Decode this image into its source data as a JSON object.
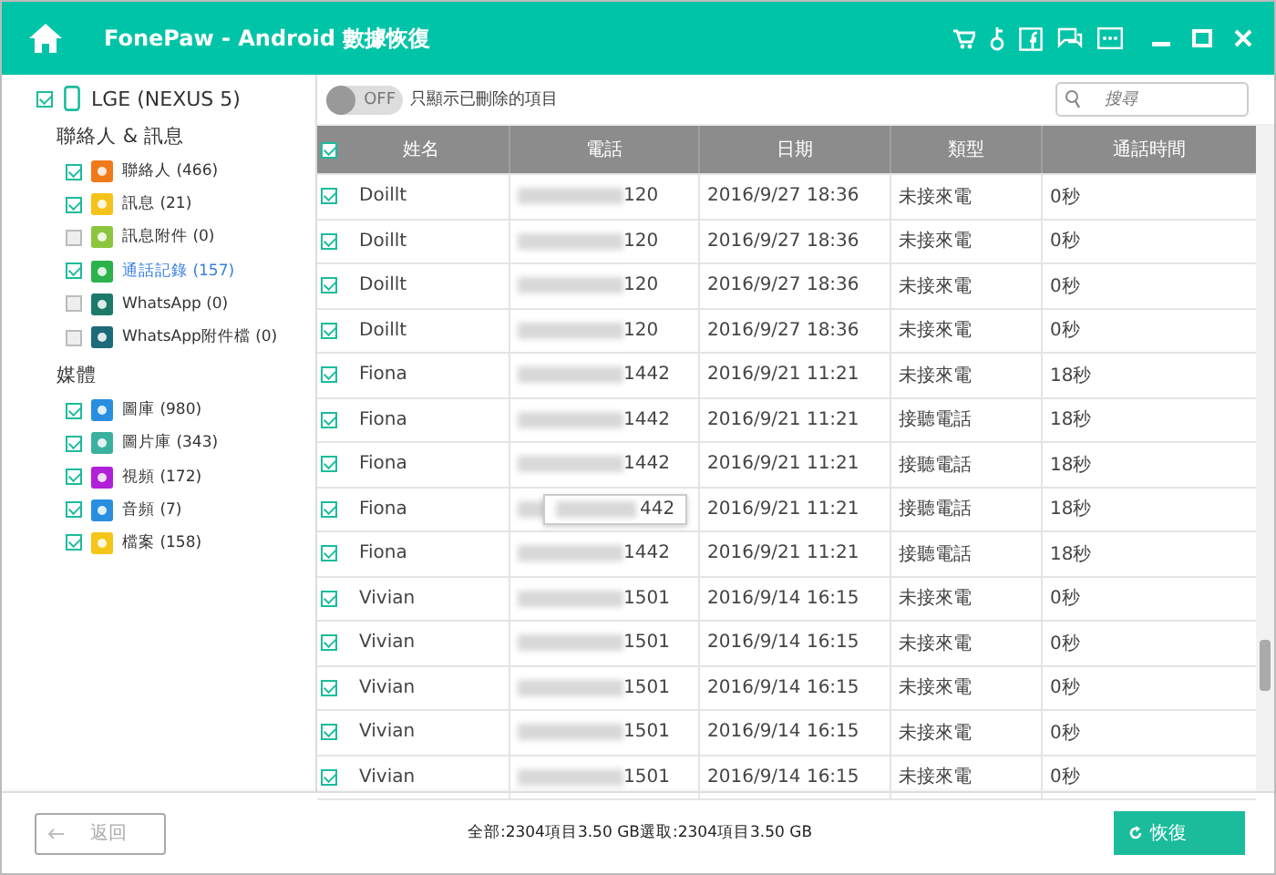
{
  "window": {
    "title": "FonePaw - Android 數據恢復"
  },
  "device": {
    "name": "LGE (NEXUS 5)",
    "checked": true
  },
  "groups": [
    {
      "title": "聯絡人 & 訊息",
      "items": [
        {
          "kind": "contacts",
          "label": "聯絡人 (466)",
          "checked": true,
          "selected": false
        },
        {
          "kind": "messages",
          "label": "訊息 (21)",
          "checked": true,
          "selected": false
        },
        {
          "kind": "attachments",
          "label": "訊息附件 (0)",
          "checked": false,
          "selected": false
        },
        {
          "kind": "calls",
          "label": "通話記錄 (157)",
          "checked": true,
          "selected": true
        },
        {
          "kind": "whatsapp",
          "label": "WhatsApp (0)",
          "checked": false,
          "selected": false
        },
        {
          "kind": "whatsapp-attachments",
          "label": "WhatsApp附件檔 (0)",
          "checked": false,
          "selected": false
        }
      ]
    },
    {
      "title": "媒體",
      "items": [
        {
          "kind": "gallery",
          "label": "圖庫 (980)",
          "checked": true,
          "selected": false
        },
        {
          "kind": "pictures",
          "label": "圖片庫 (343)",
          "checked": true,
          "selected": false
        },
        {
          "kind": "video",
          "label": "視頻 (172)",
          "checked": true,
          "selected": false
        },
        {
          "kind": "audio",
          "label": "音頻 (7)",
          "checked": true,
          "selected": false
        },
        {
          "kind": "files",
          "label": "檔案 (158)",
          "checked": true,
          "selected": false
        }
      ]
    }
  ],
  "toggle": {
    "on": false,
    "label": "OFF",
    "text": "只顯示已刪除的項目"
  },
  "search": {
    "placeholder": "搜尋"
  },
  "table": {
    "all_checked": true,
    "columns": [
      "姓名",
      "電話",
      "日期",
      "類型",
      "通話時間"
    ],
    "rows": [
      {
        "checked": true,
        "name": "Doillt",
        "phone": "120",
        "date": "2016/9/27 18:36",
        "type": "未接來電",
        "duration": "0秒"
      },
      {
        "checked": true,
        "name": "Doillt",
        "phone": "120",
        "date": "2016/9/27 18:36",
        "type": "未接來電",
        "duration": "0秒"
      },
      {
        "checked": true,
        "name": "Doillt",
        "phone": "120",
        "date": "2016/9/27 18:36",
        "type": "未接來電",
        "duration": "0秒"
      },
      {
        "checked": true,
        "name": "Doillt",
        "phone": "120",
        "date": "2016/9/27 18:36",
        "type": "未接來電",
        "duration": "0秒"
      },
      {
        "checked": true,
        "name": "Fiona",
        "phone": "1442",
        "date": "2016/9/21 11:21",
        "type": "未接來電",
        "duration": "18秒"
      },
      {
        "checked": true,
        "name": "Fiona",
        "phone": "1442",
        "date": "2016/9/21 11:21",
        "type": "接聽電話",
        "duration": "18秒"
      },
      {
        "checked": true,
        "name": "Fiona",
        "phone": "1442",
        "date": "2016/9/21 11:21",
        "type": "接聽電話",
        "duration": "18秒"
      },
      {
        "checked": true,
        "name": "Fiona",
        "date": "2016/9/21 11:21",
        "type": "接聽電話",
        "duration": "18秒",
        "tooltip": "442"
      },
      {
        "checked": true,
        "name": "Fiona",
        "phone": "1442",
        "date": "2016/9/21 11:21",
        "type": "接聽電話",
        "duration": "18秒"
      },
      {
        "checked": true,
        "name": "Vivian",
        "phone": "1501",
        "date": "2016/9/14 16:15",
        "type": "未接來電",
        "duration": "0秒"
      },
      {
        "checked": true,
        "name": "Vivian",
        "phone": "1501",
        "date": "2016/9/14 16:15",
        "type": "未接來電",
        "duration": "0秒"
      },
      {
        "checked": true,
        "name": "Vivian",
        "phone": "1501",
        "date": "2016/9/14 16:15",
        "type": "未接來電",
        "duration": "0秒"
      },
      {
        "checked": true,
        "name": "Vivian",
        "phone": "1501",
        "date": "2016/9/14 16:15",
        "type": "未接來電",
        "duration": "0秒"
      },
      {
        "checked": true,
        "name": "Vivian",
        "phone": "1501",
        "date": "2016/9/14 16:15",
        "type": "未接來電",
        "duration": "0秒"
      }
    ]
  },
  "footer": {
    "back": "返回",
    "summary": "全部:2304項目3.50 GB選取:2304項目3.50 GB",
    "recover": "恢復"
  }
}
